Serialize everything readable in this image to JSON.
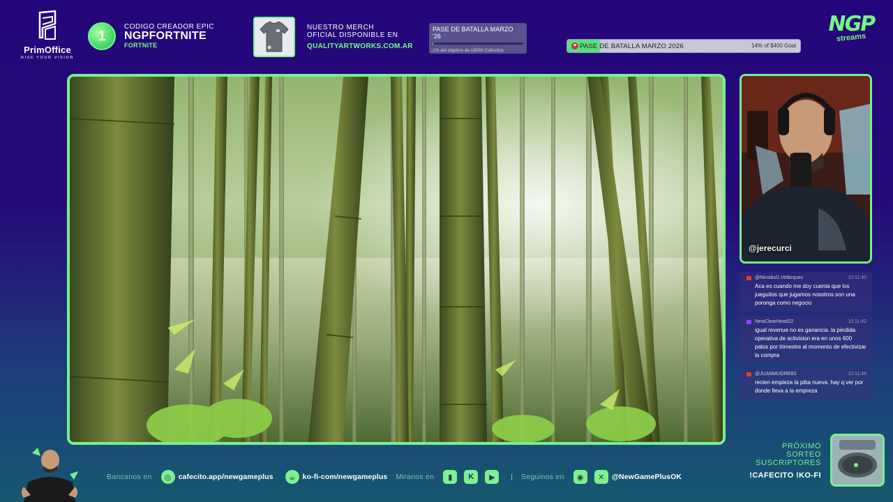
{
  "branding": {
    "sponsor_name": "PrimOffice",
    "sponsor_tagline": "RISE YOUR VISION",
    "channel_logo": "NGP",
    "channel_logo_sub": "streams"
  },
  "creator_code": {
    "label": "CODIGO CREADOR EPIC",
    "code": "NGPFORTNITE",
    "game": "FORTNITE",
    "badge_icon": "fortnite-badge-icon"
  },
  "merch": {
    "line1": "NUESTRO MERCH",
    "line2": "OFICIAL DISPONIBLE EN",
    "url": "QUALITYARTWORKS.COM.AR"
  },
  "goal_widget_small": {
    "title": "PASE DE BATALLA MARZO '26",
    "subtitle": "1% del objetivo de 15000 Cafecitos",
    "progress": 0.01
  },
  "goal_widget_bar": {
    "title": "PASE DE BATALLA MARZO 2026",
    "status": "14% of $400 Goal",
    "progress": 0.14
  },
  "cam": {
    "handle": "@jerecurci"
  },
  "chat": {
    "messages": [
      {
        "user": "@NicolásD.Velázquez",
        "time": "10:11:40",
        "platform": "youtube",
        "platform_color": "#e53b3b",
        "text": "Aca es cuando me doy cuenta que los jueguitos que jugamos nosotros son una poronga como negocio"
      },
      {
        "user": "NewClearHead22",
        "time": "10:11:42",
        "platform": "twitch",
        "platform_color": "#9146ff",
        "text": "igual revenue no es ganancia. la pérdida operativa de activision era en unos 600 palos por trimestre al momento de efectivizar la compra"
      },
      {
        "user": "@JUANMUGRE83",
        "time": "10:11:48",
        "platform": "youtube",
        "platform_color": "#e53b3b",
        "text": "recien empieza la piba nueva. hay q ver por donde lleva a la empreza"
      }
    ]
  },
  "bottom": {
    "bancanos_label": "Bancanos en",
    "cafecito_link": "cafecito.app/newgameplus",
    "kofi_link": "ko-fi-com/newgameplus",
    "miranos_label": "Miranos en",
    "seguinos_label": "Seguinos en",
    "social_handle": "@NewGamePlusOK",
    "separator": "|"
  },
  "sorteo": {
    "line1": "PRÓXIMO",
    "line2": "SORTEO",
    "line3": "SUSCRIPTORES",
    "cta": "!CAFECITO !KO-FI"
  },
  "colors": {
    "accent_green": "#77f08e",
    "background_top": "#24067a",
    "background_bottom": "#17586f"
  }
}
